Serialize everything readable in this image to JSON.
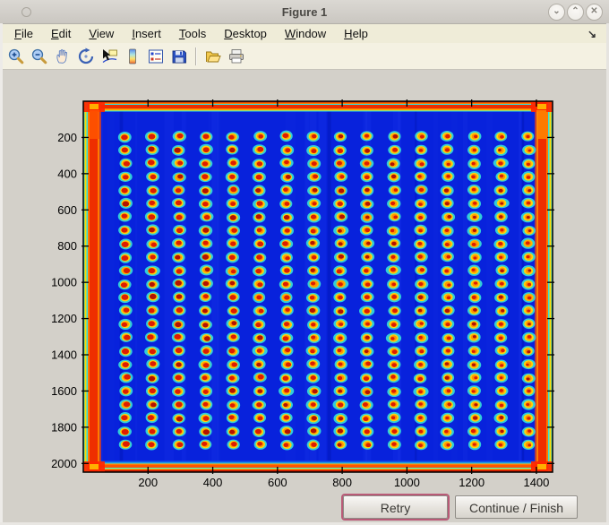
{
  "window": {
    "title": "Figure 1",
    "controls": {
      "shade": "⌄",
      "unshade": "⌃",
      "close": "✕"
    }
  },
  "menu": {
    "items": [
      "File",
      "Edit",
      "View",
      "Insert",
      "Tools",
      "Desktop",
      "Window",
      "Help"
    ],
    "dock_arrow": "↘"
  },
  "toolbar": {
    "icons": [
      "zoom-in-icon",
      "zoom-out-icon",
      "pan-hand-icon",
      "rotate-3d-icon",
      "data-cursor-icon",
      "colorbar-icon",
      "legend-icon",
      "save-icon",
      "open-folder-icon",
      "print-icon"
    ]
  },
  "axes": {
    "xticks": [
      200,
      400,
      600,
      800,
      1000,
      1200,
      1400
    ],
    "yticks": [
      200,
      400,
      600,
      800,
      1000,
      1200,
      1400,
      1600,
      1800,
      2000
    ]
  },
  "chart_data": {
    "type": "heatmap",
    "title": "",
    "xlabel": "",
    "ylabel": "",
    "description": "Jet-colormap scan of a microarray/microtiter plate: 16 x 24 grid of spots (red-orange cores, yellow rings, cyan halos) on a saturated blue background, with red/orange saturated bands along all four plate edges and bright corners.",
    "x_axis": {
      "ticks": [
        200,
        400,
        600,
        800,
        1000,
        1200,
        1400
      ],
      "range": [
        0,
        1450
      ]
    },
    "y_axis": {
      "ticks": [
        200,
        400,
        600,
        800,
        1000,
        1200,
        1400,
        1600,
        1800,
        2000
      ],
      "range": [
        0,
        2048
      ],
      "direction": "down"
    },
    "grid": {
      "cols": 16,
      "rows": 24,
      "x_start": 130,
      "x_step": 83,
      "y_start": 195,
      "y_step": 74
    },
    "palette": {
      "background_blue": "#0822dc",
      "stripe_blue": "#2a46f5",
      "seam_blue": "#0016b8",
      "halo_cyan": "#35dcd8",
      "ring_yellow": "#ffd60a",
      "inner_orange": "#ff9100",
      "core_red": "#dd1c00",
      "core_dark_red": "#b31200",
      "edge_red": "#ee2e00",
      "edge_orange": "#ff7b00",
      "edge_yellow": "#ffd800",
      "edge_cyan": "#2fe0e0",
      "corner_red": "#ff2600",
      "corner_yellow": "#ffc800"
    }
  },
  "buttons": {
    "retry": "Retry",
    "continue": "Continue / Finish"
  }
}
